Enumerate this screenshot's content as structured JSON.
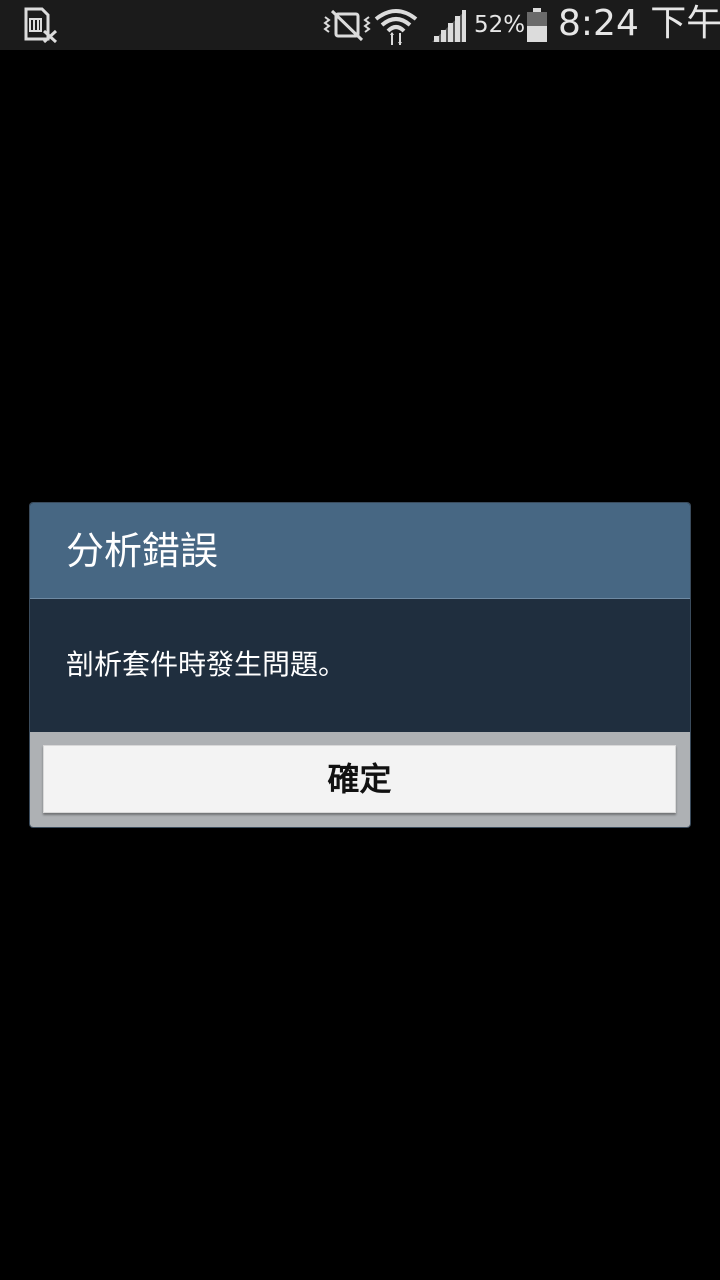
{
  "status_bar": {
    "icons": [
      "sim-no-card-icon",
      "vibrate-mode-icon",
      "wifi-icon",
      "signal-bars-icon",
      "battery-icon"
    ],
    "battery_percent": "52%",
    "battery_level": 0.52,
    "time": "8:24 下午"
  },
  "dialog": {
    "title": "分析錯誤",
    "message": "剖析套件時發生問題。",
    "ok_label": "確定"
  },
  "colors": {
    "status_bar_bg": "#1b1b1b",
    "dialog_header_bg": "#476783",
    "dialog_body_bg": "#1f2e3e",
    "dialog_footer_bg": "#aeb1b4",
    "button_bg": "#f3f3f3"
  }
}
